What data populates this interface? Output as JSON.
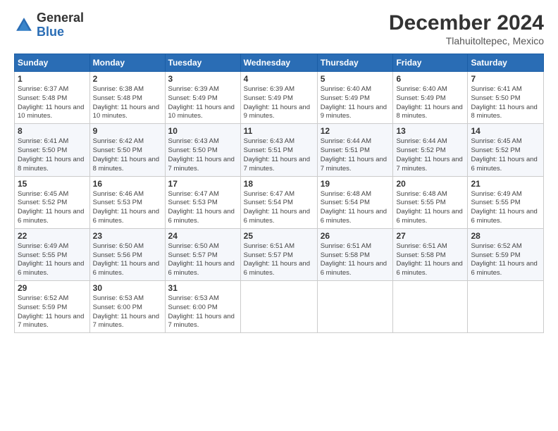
{
  "logo": {
    "general": "General",
    "blue": "Blue"
  },
  "title": "December 2024",
  "subtitle": "Tlahuitoltepec, Mexico",
  "days_header": [
    "Sunday",
    "Monday",
    "Tuesday",
    "Wednesday",
    "Thursday",
    "Friday",
    "Saturday"
  ],
  "weeks": [
    [
      {
        "day": "1",
        "sunrise": "6:37 AM",
        "sunset": "5:48 PM",
        "daylight": "11 hours and 10 minutes."
      },
      {
        "day": "2",
        "sunrise": "6:38 AM",
        "sunset": "5:48 PM",
        "daylight": "11 hours and 10 minutes."
      },
      {
        "day": "3",
        "sunrise": "6:39 AM",
        "sunset": "5:49 PM",
        "daylight": "11 hours and 10 minutes."
      },
      {
        "day": "4",
        "sunrise": "6:39 AM",
        "sunset": "5:49 PM",
        "daylight": "11 hours and 9 minutes."
      },
      {
        "day": "5",
        "sunrise": "6:40 AM",
        "sunset": "5:49 PM",
        "daylight": "11 hours and 9 minutes."
      },
      {
        "day": "6",
        "sunrise": "6:40 AM",
        "sunset": "5:49 PM",
        "daylight": "11 hours and 8 minutes."
      },
      {
        "day": "7",
        "sunrise": "6:41 AM",
        "sunset": "5:50 PM",
        "daylight": "11 hours and 8 minutes."
      }
    ],
    [
      {
        "day": "8",
        "sunrise": "6:41 AM",
        "sunset": "5:50 PM",
        "daylight": "11 hours and 8 minutes."
      },
      {
        "day": "9",
        "sunrise": "6:42 AM",
        "sunset": "5:50 PM",
        "daylight": "11 hours and 8 minutes."
      },
      {
        "day": "10",
        "sunrise": "6:43 AM",
        "sunset": "5:50 PM",
        "daylight": "11 hours and 7 minutes."
      },
      {
        "day": "11",
        "sunrise": "6:43 AM",
        "sunset": "5:51 PM",
        "daylight": "11 hours and 7 minutes."
      },
      {
        "day": "12",
        "sunrise": "6:44 AM",
        "sunset": "5:51 PM",
        "daylight": "11 hours and 7 minutes."
      },
      {
        "day": "13",
        "sunrise": "6:44 AM",
        "sunset": "5:52 PM",
        "daylight": "11 hours and 7 minutes."
      },
      {
        "day": "14",
        "sunrise": "6:45 AM",
        "sunset": "5:52 PM",
        "daylight": "11 hours and 6 minutes."
      }
    ],
    [
      {
        "day": "15",
        "sunrise": "6:45 AM",
        "sunset": "5:52 PM",
        "daylight": "11 hours and 6 minutes."
      },
      {
        "day": "16",
        "sunrise": "6:46 AM",
        "sunset": "5:53 PM",
        "daylight": "11 hours and 6 minutes."
      },
      {
        "day": "17",
        "sunrise": "6:47 AM",
        "sunset": "5:53 PM",
        "daylight": "11 hours and 6 minutes."
      },
      {
        "day": "18",
        "sunrise": "6:47 AM",
        "sunset": "5:54 PM",
        "daylight": "11 hours and 6 minutes."
      },
      {
        "day": "19",
        "sunrise": "6:48 AM",
        "sunset": "5:54 PM",
        "daylight": "11 hours and 6 minutes."
      },
      {
        "day": "20",
        "sunrise": "6:48 AM",
        "sunset": "5:55 PM",
        "daylight": "11 hours and 6 minutes."
      },
      {
        "day": "21",
        "sunrise": "6:49 AM",
        "sunset": "5:55 PM",
        "daylight": "11 hours and 6 minutes."
      }
    ],
    [
      {
        "day": "22",
        "sunrise": "6:49 AM",
        "sunset": "5:55 PM",
        "daylight": "11 hours and 6 minutes."
      },
      {
        "day": "23",
        "sunrise": "6:50 AM",
        "sunset": "5:56 PM",
        "daylight": "11 hours and 6 minutes."
      },
      {
        "day": "24",
        "sunrise": "6:50 AM",
        "sunset": "5:57 PM",
        "daylight": "11 hours and 6 minutes."
      },
      {
        "day": "25",
        "sunrise": "6:51 AM",
        "sunset": "5:57 PM",
        "daylight": "11 hours and 6 minutes."
      },
      {
        "day": "26",
        "sunrise": "6:51 AM",
        "sunset": "5:58 PM",
        "daylight": "11 hours and 6 minutes."
      },
      {
        "day": "27",
        "sunrise": "6:51 AM",
        "sunset": "5:58 PM",
        "daylight": "11 hours and 6 minutes."
      },
      {
        "day": "28",
        "sunrise": "6:52 AM",
        "sunset": "5:59 PM",
        "daylight": "11 hours and 6 minutes."
      }
    ],
    [
      {
        "day": "29",
        "sunrise": "6:52 AM",
        "sunset": "5:59 PM",
        "daylight": "11 hours and 7 minutes."
      },
      {
        "day": "30",
        "sunrise": "6:53 AM",
        "sunset": "6:00 PM",
        "daylight": "11 hours and 7 minutes."
      },
      {
        "day": "31",
        "sunrise": "6:53 AM",
        "sunset": "6:00 PM",
        "daylight": "11 hours and 7 minutes."
      },
      null,
      null,
      null,
      null
    ]
  ]
}
